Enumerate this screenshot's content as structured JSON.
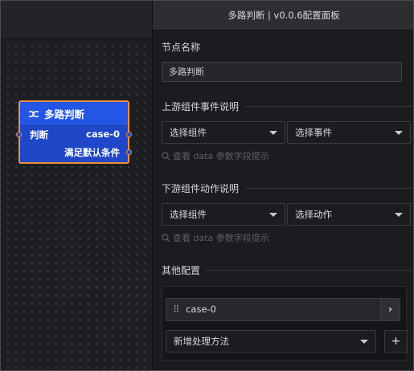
{
  "node": {
    "title": "多路判断",
    "input_label": "判断",
    "output_case": "case-0",
    "output_default": "满足默认条件",
    "icon": "branch-icon"
  },
  "panel": {
    "title": "多路判断 | v0.0.6配置面板",
    "node_name_label": "节点名称",
    "node_name_value": "多路判断",
    "upstream_label": "上游组件事件说明",
    "upstream_component_select": "选择组件",
    "upstream_event_select": "选择事件",
    "upstream_hint": "查看 data 参数字段提示",
    "downstream_label": "下游组件动作说明",
    "downstream_component_select": "选择组件",
    "downstream_action_select": "选择动作",
    "downstream_hint": "查看 data 参数字段提示",
    "other_label": "其他配置",
    "case_item": "case-0",
    "add_method_select": "新增处理方法",
    "add_button": "+"
  },
  "colors": {
    "node_fill": "#2356e6",
    "node_border": "#f0903e",
    "panel_bg": "#1b1c1f"
  }
}
